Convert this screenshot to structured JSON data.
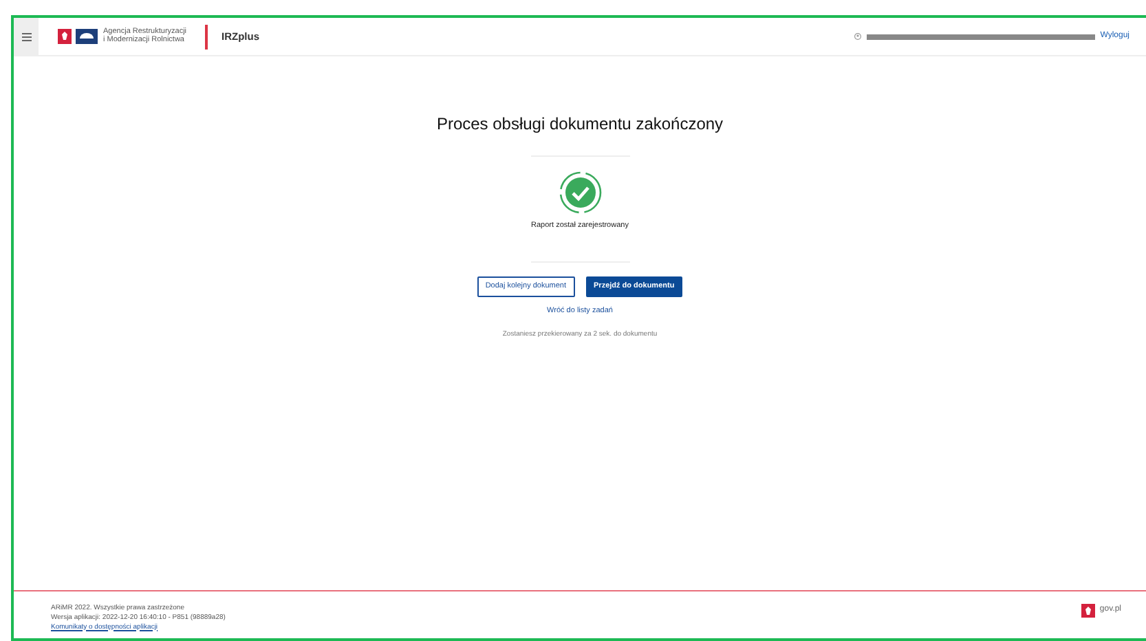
{
  "header": {
    "agency_name": "Agencja Restrukturyzacji i Modernizacji Rolnictwa",
    "app_name": "IRZplus",
    "logout": "Wyloguj"
  },
  "main": {
    "title": "Proces obsługi dokumentu zakończony",
    "status": "Raport został zarejestrowany",
    "buttons": [
      {
        "label": "Dodaj kolejny dokument",
        "kind": "outline"
      },
      {
        "label": "Przejdź do dokumentu",
        "kind": "primary"
      }
    ],
    "back_link": "Wróć do listy zadań",
    "redirect_note": "Zostaniesz przekierowany za 2 sek. do dokumentu"
  },
  "footer": {
    "copyright": "ARiMR 2022. Wszystkie prawa zastrzeżone",
    "version": "Wersja aplikacji: 2022-12-20 16:40:10 - P851 (98889a28)",
    "link": "Komunikaty o dostępności aplikacji",
    "gov": "gov.pl"
  }
}
